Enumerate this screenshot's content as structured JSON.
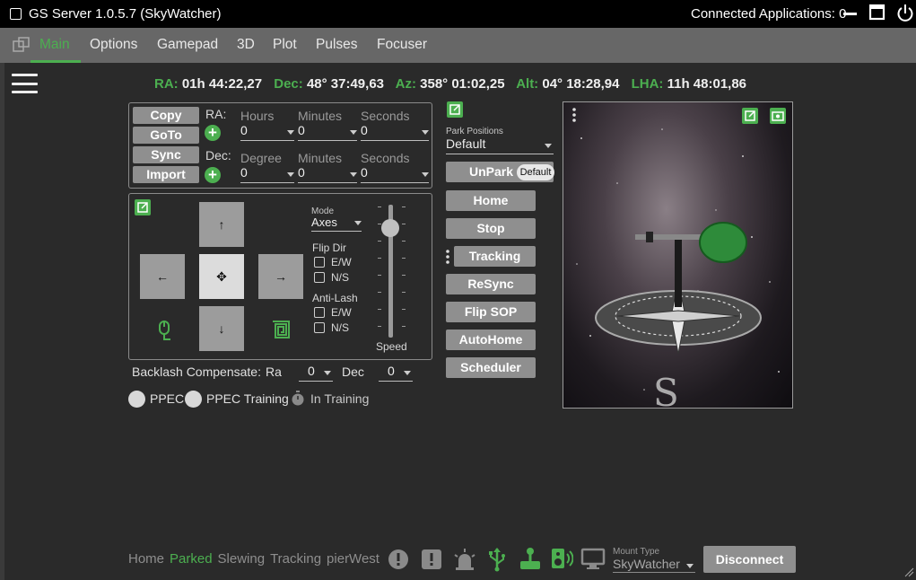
{
  "titlebar": {
    "title": "GS Server 1.0.5.7 (SkyWatcher)",
    "connected": "Connected Applications: 0",
    "minimize_icon": "minimize-icon",
    "maximize_icon": "maximize-icon",
    "power_icon": "power-icon"
  },
  "tabs": [
    "Main",
    "Options",
    "Gamepad",
    "3D",
    "Plot",
    "Pulses",
    "Focuser"
  ],
  "coords": {
    "ra_label": "RA:",
    "ra": "01h 44:22,27",
    "dec_label": "Dec:",
    "dec": "48° 37:49,63",
    "az_label": "Az:",
    "az": "358° 01:02,25",
    "alt_label": "Alt:",
    "alt": "04° 18:28,94",
    "lha_label": "LHA:",
    "lha": "11h 48:01,86"
  },
  "goto_panel": {
    "copy": "Copy",
    "goto": "GoTo",
    "sync": "Sync",
    "import": "Import",
    "ra_label": "RA:",
    "dec_label": "Dec:",
    "hours_ph": "Hours",
    "minutes_ph": "Minutes",
    "seconds_ph": "Seconds",
    "degree_ph": "Degree",
    "ra_hours": "0",
    "ra_minutes": "0",
    "ra_seconds": "0",
    "dec_degree": "0",
    "dec_minutes": "0",
    "dec_seconds": "0"
  },
  "slew_panel": {
    "mode_label": "Mode",
    "mode_value": "Axes",
    "flip_dir": "Flip Dir",
    "ew": "E/W",
    "ns": "N/S",
    "anti_lash": "Anti-Lash",
    "ew2": "E/W",
    "ns2": "N/S",
    "speed": "Speed"
  },
  "backlash": {
    "label": "Backlash Compensate:",
    "ra_label": "Ra",
    "ra_value": "0",
    "dec_label": "Dec",
    "dec_value": "0"
  },
  "ppec": {
    "ppec": "PPEC",
    "ppec_training": "PPEC Training",
    "in_training": "In Training"
  },
  "park": {
    "label": "Park Positions",
    "value": "Default"
  },
  "commands": {
    "unpark": "UnPark",
    "unpark_badge": "Default",
    "home": "Home",
    "stop": "Stop",
    "tracking": "Tracking",
    "resync": "ReSync",
    "flip_sop": "Flip SOP",
    "autohome": "AutoHome",
    "scheduler": "Scheduler"
  },
  "status": {
    "home": "Home",
    "parked": "Parked",
    "slewing": "Slewing",
    "tracking": "Tracking",
    "pierwest": "pierWest",
    "mount_type_label": "Mount Type",
    "mount_type": "SkyWatcher",
    "disconnect": "Disconnect"
  },
  "colors": {
    "accent": "#4caf50",
    "background": "#2a2a2a",
    "tabbar": "#676767",
    "button": "#8f8f8f"
  }
}
